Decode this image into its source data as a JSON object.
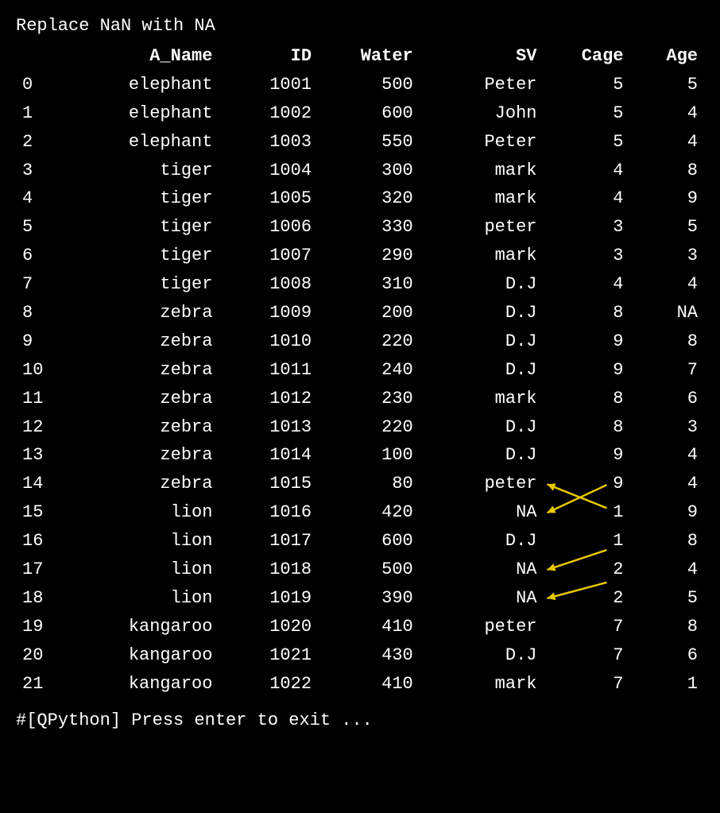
{
  "title": "Replace NaN with NA",
  "columns": [
    "",
    "A_Name",
    "ID",
    "Water",
    "SV",
    "Cage",
    "Age"
  ],
  "rows": [
    {
      "idx": "0",
      "a_name": "elephant",
      "id": "1001",
      "water": "500",
      "sv": "Peter",
      "cage": "5",
      "age": "5"
    },
    {
      "idx": "1",
      "a_name": "elephant",
      "id": "1002",
      "water": "600",
      "sv": "John",
      "cage": "5",
      "age": "4"
    },
    {
      "idx": "2",
      "a_name": "elephant",
      "id": "1003",
      "water": "550",
      "sv": "Peter",
      "cage": "5",
      "age": "4"
    },
    {
      "idx": "3",
      "a_name": "tiger",
      "id": "1004",
      "water": "300",
      "sv": "mark",
      "cage": "4",
      "age": "8"
    },
    {
      "idx": "4",
      "a_name": "tiger",
      "id": "1005",
      "water": "320",
      "sv": "mark",
      "cage": "4",
      "age": "9"
    },
    {
      "idx": "5",
      "a_name": "tiger",
      "id": "1006",
      "water": "330",
      "sv": "peter",
      "cage": "3",
      "age": "5"
    },
    {
      "idx": "6",
      "a_name": "tiger",
      "id": "1007",
      "water": "290",
      "sv": "mark",
      "cage": "3",
      "age": "3"
    },
    {
      "idx": "7",
      "a_name": "tiger",
      "id": "1008",
      "water": "310",
      "sv": "D.J",
      "cage": "4",
      "age": "4"
    },
    {
      "idx": "8",
      "a_name": "zebra",
      "id": "1009",
      "water": "200",
      "sv": "D.J",
      "cage": "8",
      "age": "NA"
    },
    {
      "idx": "9",
      "a_name": "zebra",
      "id": "1010",
      "water": "220",
      "sv": "D.J",
      "cage": "9",
      "age": "8"
    },
    {
      "idx": "10",
      "a_name": "zebra",
      "id": "1011",
      "water": "240",
      "sv": "D.J",
      "cage": "9",
      "age": "7"
    },
    {
      "idx": "11",
      "a_name": "zebra",
      "id": "1012",
      "water": "230",
      "sv": "mark",
      "cage": "8",
      "age": "6"
    },
    {
      "idx": "12",
      "a_name": "zebra",
      "id": "1013",
      "water": "220",
      "sv": "D.J",
      "cage": "8",
      "age": "3"
    },
    {
      "idx": "13",
      "a_name": "zebra",
      "id": "1014",
      "water": "100",
      "sv": "D.J",
      "cage": "9",
      "age": "4"
    },
    {
      "idx": "14",
      "a_name": "zebra",
      "id": "1015",
      "water": "80",
      "sv": "peter",
      "cage": "9",
      "age": "4"
    },
    {
      "idx": "15",
      "a_name": "lion",
      "id": "1016",
      "water": "420",
      "sv": "NA",
      "cage": "1",
      "age": "9"
    },
    {
      "idx": "16",
      "a_name": "lion",
      "id": "1017",
      "water": "600",
      "sv": "D.J",
      "cage": "1",
      "age": "8"
    },
    {
      "idx": "17",
      "a_name": "lion",
      "id": "1018",
      "water": "500",
      "sv": "NA",
      "cage": "2",
      "age": "4"
    },
    {
      "idx": "18",
      "a_name": "lion",
      "id": "1019",
      "water": "390",
      "sv": "NA",
      "cage": "2",
      "age": "5"
    },
    {
      "idx": "19",
      "a_name": "kangaroo",
      "id": "1020",
      "water": "410",
      "sv": "peter",
      "cage": "7",
      "age": "8"
    },
    {
      "idx": "20",
      "a_name": "kangaroo",
      "id": "1021",
      "water": "430",
      "sv": "D.J",
      "cage": "7",
      "age": "6"
    },
    {
      "idx": "21",
      "a_name": "kangaroo",
      "id": "1022",
      "water": "410",
      "sv": "mark",
      "cage": "7",
      "age": "1"
    }
  ],
  "footer": "#[QPython] Press enter to exit ...",
  "arrow_color": "#e8c800",
  "na_rows": {
    "age_row8": true,
    "sv_row15": true,
    "sv_row17": true,
    "sv_row18": true
  }
}
